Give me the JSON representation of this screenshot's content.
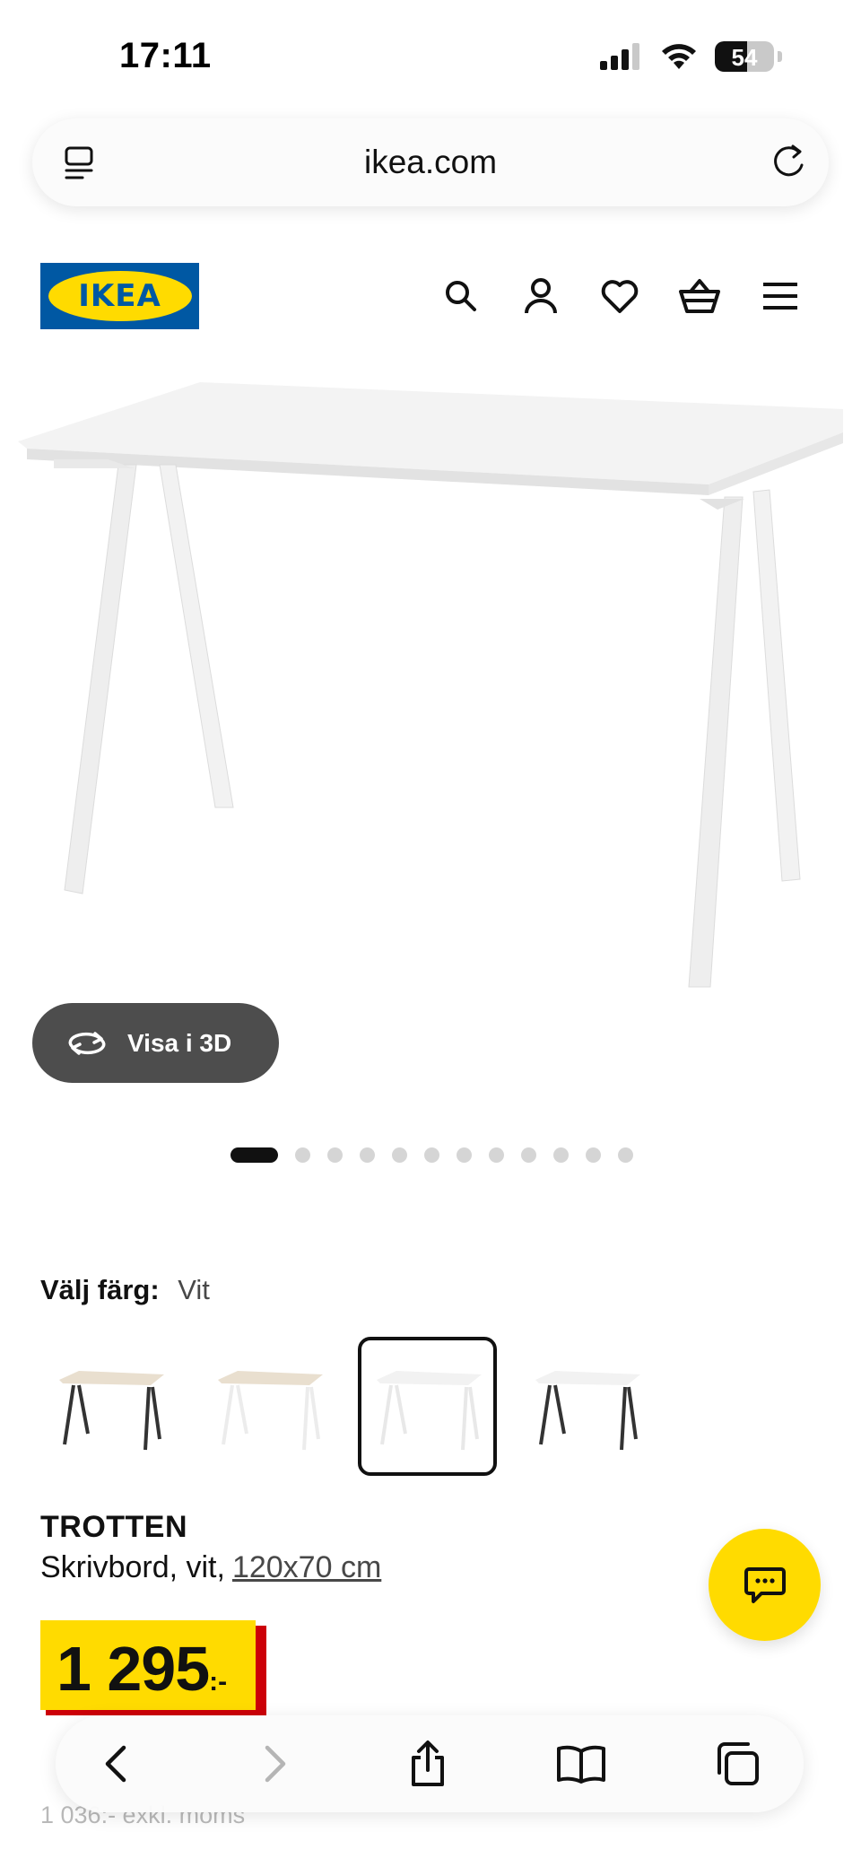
{
  "status_bar": {
    "time": "17:11",
    "battery": "54",
    "battery_level": 0.54
  },
  "browser": {
    "url": "ikea.com"
  },
  "header": {
    "logo_text": "IKEA",
    "icons": [
      "search-icon",
      "account-icon",
      "heart-icon",
      "basket-icon",
      "menu-icon"
    ]
  },
  "gallery": {
    "view_3d_label": "Visa i 3D",
    "image_count": 12,
    "active_index": 0
  },
  "color_chooser": {
    "label": "Välj färg:",
    "selected": "Vit",
    "options": [
      "Beige/antracit",
      "Beige/vit",
      "Vit",
      "Vit/antracit"
    ]
  },
  "product": {
    "name": "TROTTEN",
    "description": "Skrivbord, vit,",
    "size": "120x70 cm",
    "price": "1 295",
    "currency": ":-",
    "price_excl_vat": "1 036:- exkl. moms"
  },
  "colors": {
    "ikea_blue": "#0058a3",
    "ikea_yellow": "#ffdb00",
    "price_red": "#cc0008"
  }
}
